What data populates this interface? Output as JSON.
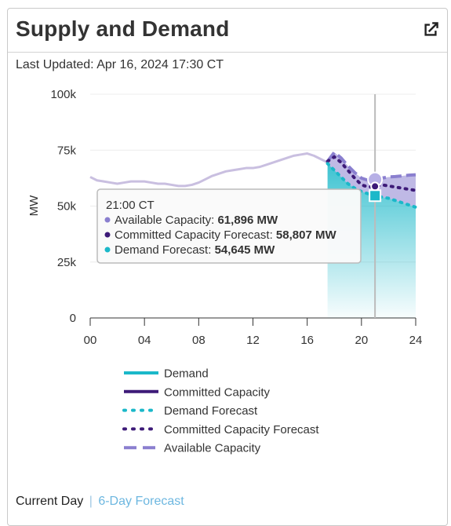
{
  "header": {
    "title": "Supply and Demand",
    "external_icon": "external-link-icon"
  },
  "updated": {
    "text": "Last Updated: Apr 16, 2024 17:30 CT"
  },
  "footer": {
    "current": "Current Day",
    "separator": "|",
    "forecast_link": "6-Day Forecast"
  },
  "colors": {
    "demand": "#1bb8c9",
    "committed": "#3d1a78",
    "demand_forecast": "#1bb8c9",
    "committed_forecast": "#3d1a78",
    "available": "#8a7fcf",
    "history": "#c9bfe0",
    "tooltip_border": "#bbbbbb"
  },
  "chart_data": {
    "type": "line",
    "xlabel": "",
    "ylabel": "MW",
    "xlim": [
      0,
      24
    ],
    "ylim": [
      0,
      100000
    ],
    "x_ticks": [
      "00",
      "04",
      "08",
      "12",
      "16",
      "20",
      "24"
    ],
    "y_ticks": [
      "0",
      "25k",
      "50k",
      "75k",
      "100k"
    ],
    "series": [
      {
        "name": "Demand",
        "style": "solid",
        "x": [],
        "y": []
      },
      {
        "name": "Committed Capacity",
        "style": "solid",
        "x": [],
        "y": []
      },
      {
        "name": "Demand Forecast",
        "style": "dotted",
        "x": [
          17.5,
          18,
          18.5,
          19,
          19.5,
          20,
          20.5,
          21,
          21.5,
          22,
          22.5,
          23,
          23.5,
          24
        ],
        "y": [
          69000,
          66000,
          63000,
          60000,
          58000,
          56500,
          55500,
          54645,
          54000,
          53500,
          52500,
          51500,
          50500,
          49500
        ]
      },
      {
        "name": "Committed Capacity Forecast",
        "style": "dotted",
        "x": [
          17.5,
          18,
          18.5,
          19,
          19.5,
          20,
          20.5,
          21,
          21.5,
          22,
          22.5,
          23,
          23.5,
          24
        ],
        "y": [
          70000,
          72000,
          69500,
          66000,
          62500,
          59500,
          58500,
          58807,
          59500,
          59000,
          58500,
          58000,
          57500,
          57000
        ]
      },
      {
        "name": "Available Capacity",
        "style": "dashed",
        "x": [
          17.5,
          18,
          18.5,
          19,
          19.5,
          20,
          20.5,
          21,
          21.5,
          22,
          22.5,
          23,
          23.5,
          24
        ],
        "y": [
          70000,
          74000,
          71500,
          68000,
          65000,
          62500,
          61500,
          61896,
          62500,
          63000,
          63200,
          63500,
          63800,
          64000
        ]
      },
      {
        "name": "",
        "style": "history",
        "x": [
          0,
          0.5,
          1,
          1.5,
          2,
          2.5,
          3,
          3.5,
          4,
          4.5,
          5,
          5.5,
          6,
          6.5,
          7,
          7.5,
          8,
          8.5,
          9,
          9.5,
          10,
          10.5,
          11,
          11.5,
          12,
          12.5,
          13,
          13.5,
          14,
          14.5,
          15,
          15.5,
          16,
          16.5,
          17,
          17.5
        ],
        "y": [
          63000,
          61500,
          61000,
          60500,
          60000,
          60500,
          61000,
          61000,
          61000,
          60500,
          60000,
          60000,
          59500,
          59000,
          59000,
          59500,
          60500,
          62000,
          63500,
          64500,
          65500,
          66000,
          66500,
          67000,
          67000,
          67500,
          68500,
          69500,
          70500,
          71500,
          72500,
          73000,
          73500,
          72500,
          71000,
          69500
        ]
      }
    ],
    "cursor_x": 21,
    "tooltip": {
      "title": "21:00 CT",
      "rows": [
        {
          "label": "Available Capacity: ",
          "value": "61,896 MW",
          "color": "#8a7fcf"
        },
        {
          "label": "Committed Capacity Forecast: ",
          "value": "58,807 MW",
          "color": "#3d1a78"
        },
        {
          "label": "Demand Forecast: ",
          "value": "54,645 MW",
          "color": "#1bb8c9"
        }
      ]
    },
    "legend": {
      "placement": "bottom",
      "items": [
        {
          "label": "Demand",
          "style": "solid",
          "color": "#1bb8c9"
        },
        {
          "label": "Committed Capacity",
          "style": "solid",
          "color": "#3d1a78"
        },
        {
          "label": "Demand Forecast",
          "style": "dotted",
          "color": "#1bb8c9"
        },
        {
          "label": "Committed Capacity Forecast",
          "style": "dotted",
          "color": "#3d1a78"
        },
        {
          "label": "Available Capacity",
          "style": "dashed",
          "color": "#8a7fcf"
        }
      ]
    },
    "grid": true
  }
}
